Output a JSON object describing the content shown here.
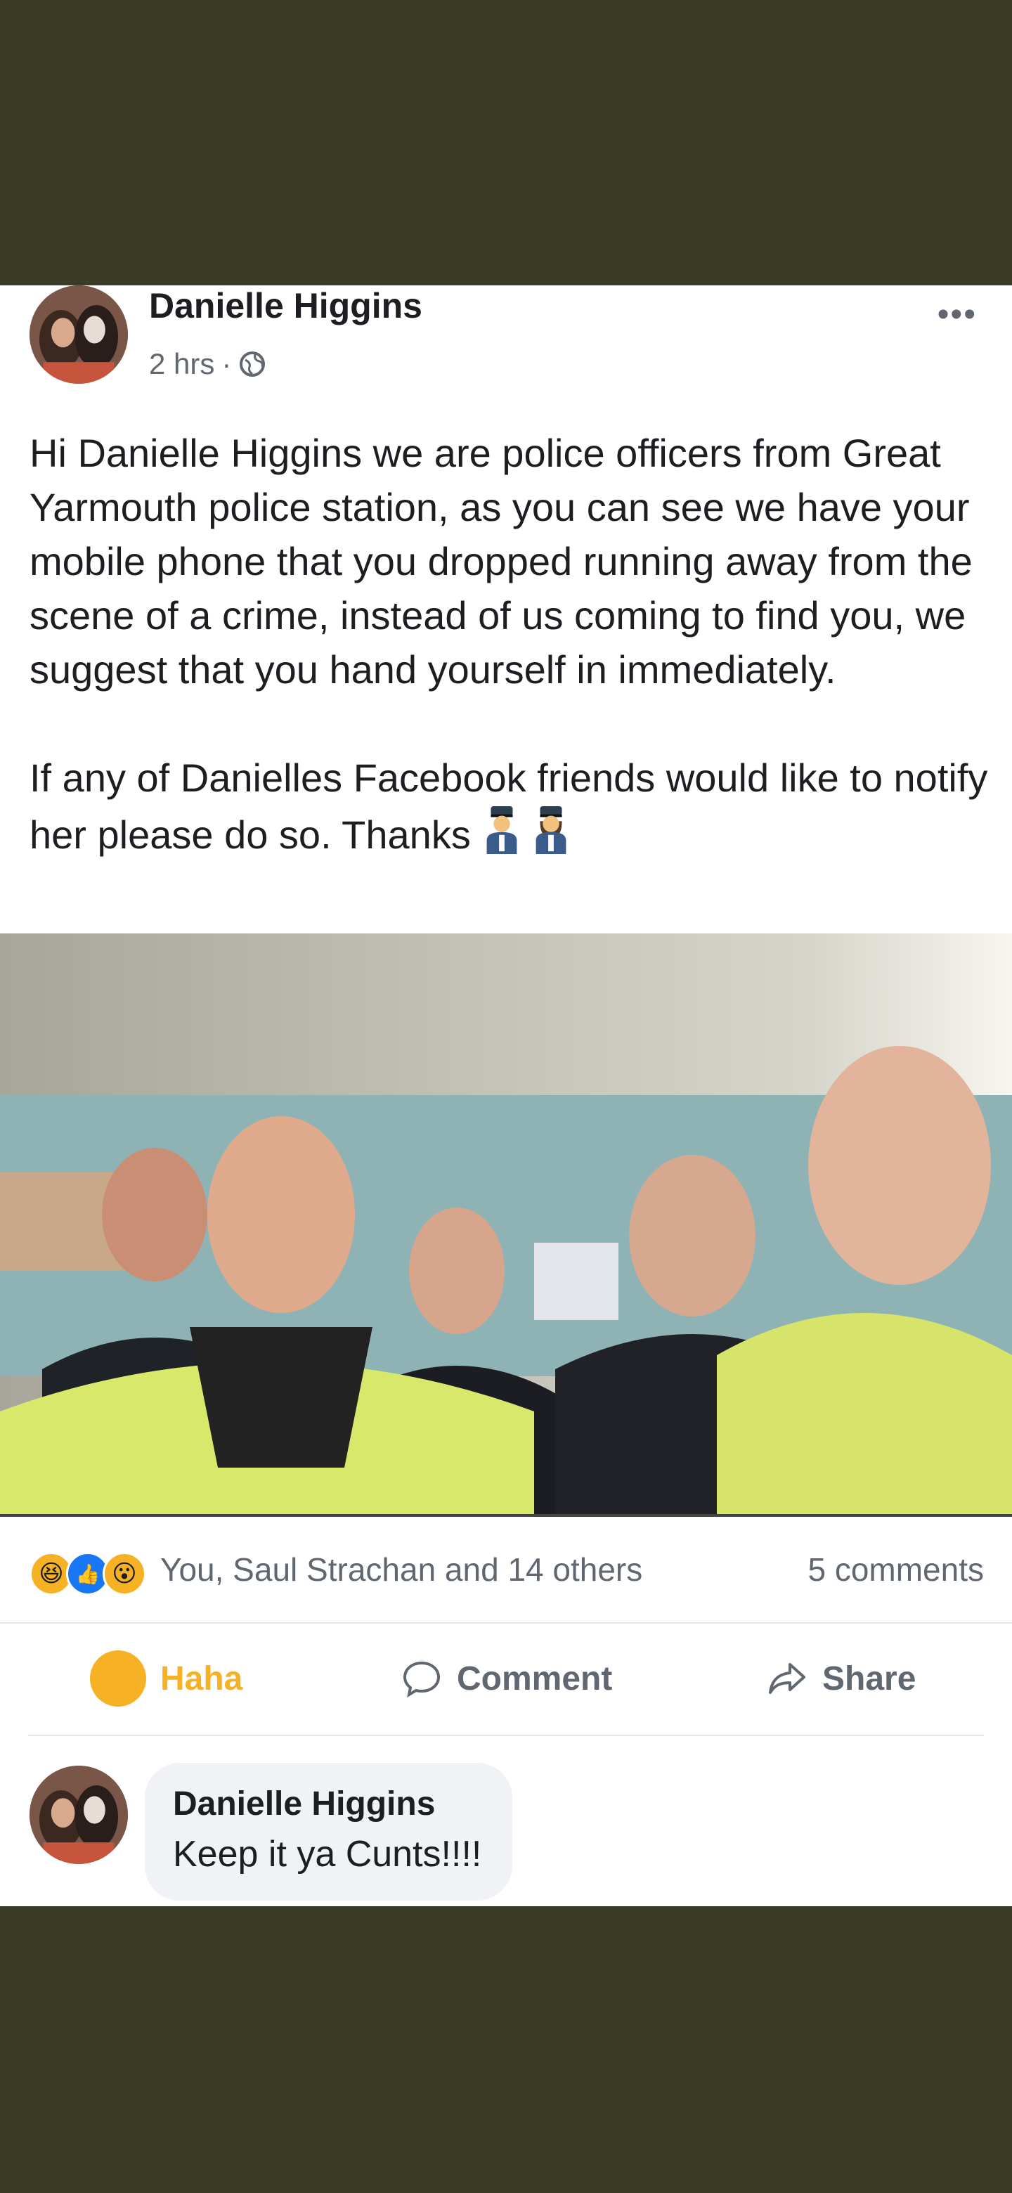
{
  "post": {
    "author": "Danielle Higgins",
    "time": "2 hrs",
    "separator": "·",
    "more_icon": "•••",
    "paragraph1": "Hi Danielle Higgins we are police officers from Great Yarmouth police station, as you can see we have your mobile phone that you dropped running away from the scene of a crime, instead of us coming to find you, we suggest that you hand yourself in immediately.",
    "paragraph2": "If any of Danielles Facebook friends would like to notify her please do so. Thanks",
    "icons": [
      "globe-icon",
      "male-police-officer-icon",
      "female-police-officer-icon"
    ]
  },
  "reactions": {
    "icons": [
      "haha-reaction-icon",
      "like-reaction-icon",
      "wow-reaction-icon"
    ],
    "summary": "You, Saul Strachan and 14 others",
    "comments": "5 comments"
  },
  "actions": {
    "haha": "Haha",
    "comment": "Comment",
    "share": "Share"
  },
  "comment": {
    "author": "Danielle Higgins",
    "text": "Keep it ya Cunts!!!!"
  },
  "colors": {
    "background": "#3a3c25",
    "card": "#ffffff",
    "haha": "#f7b125",
    "like": "#1877f2",
    "secondary_text": "#606770"
  }
}
